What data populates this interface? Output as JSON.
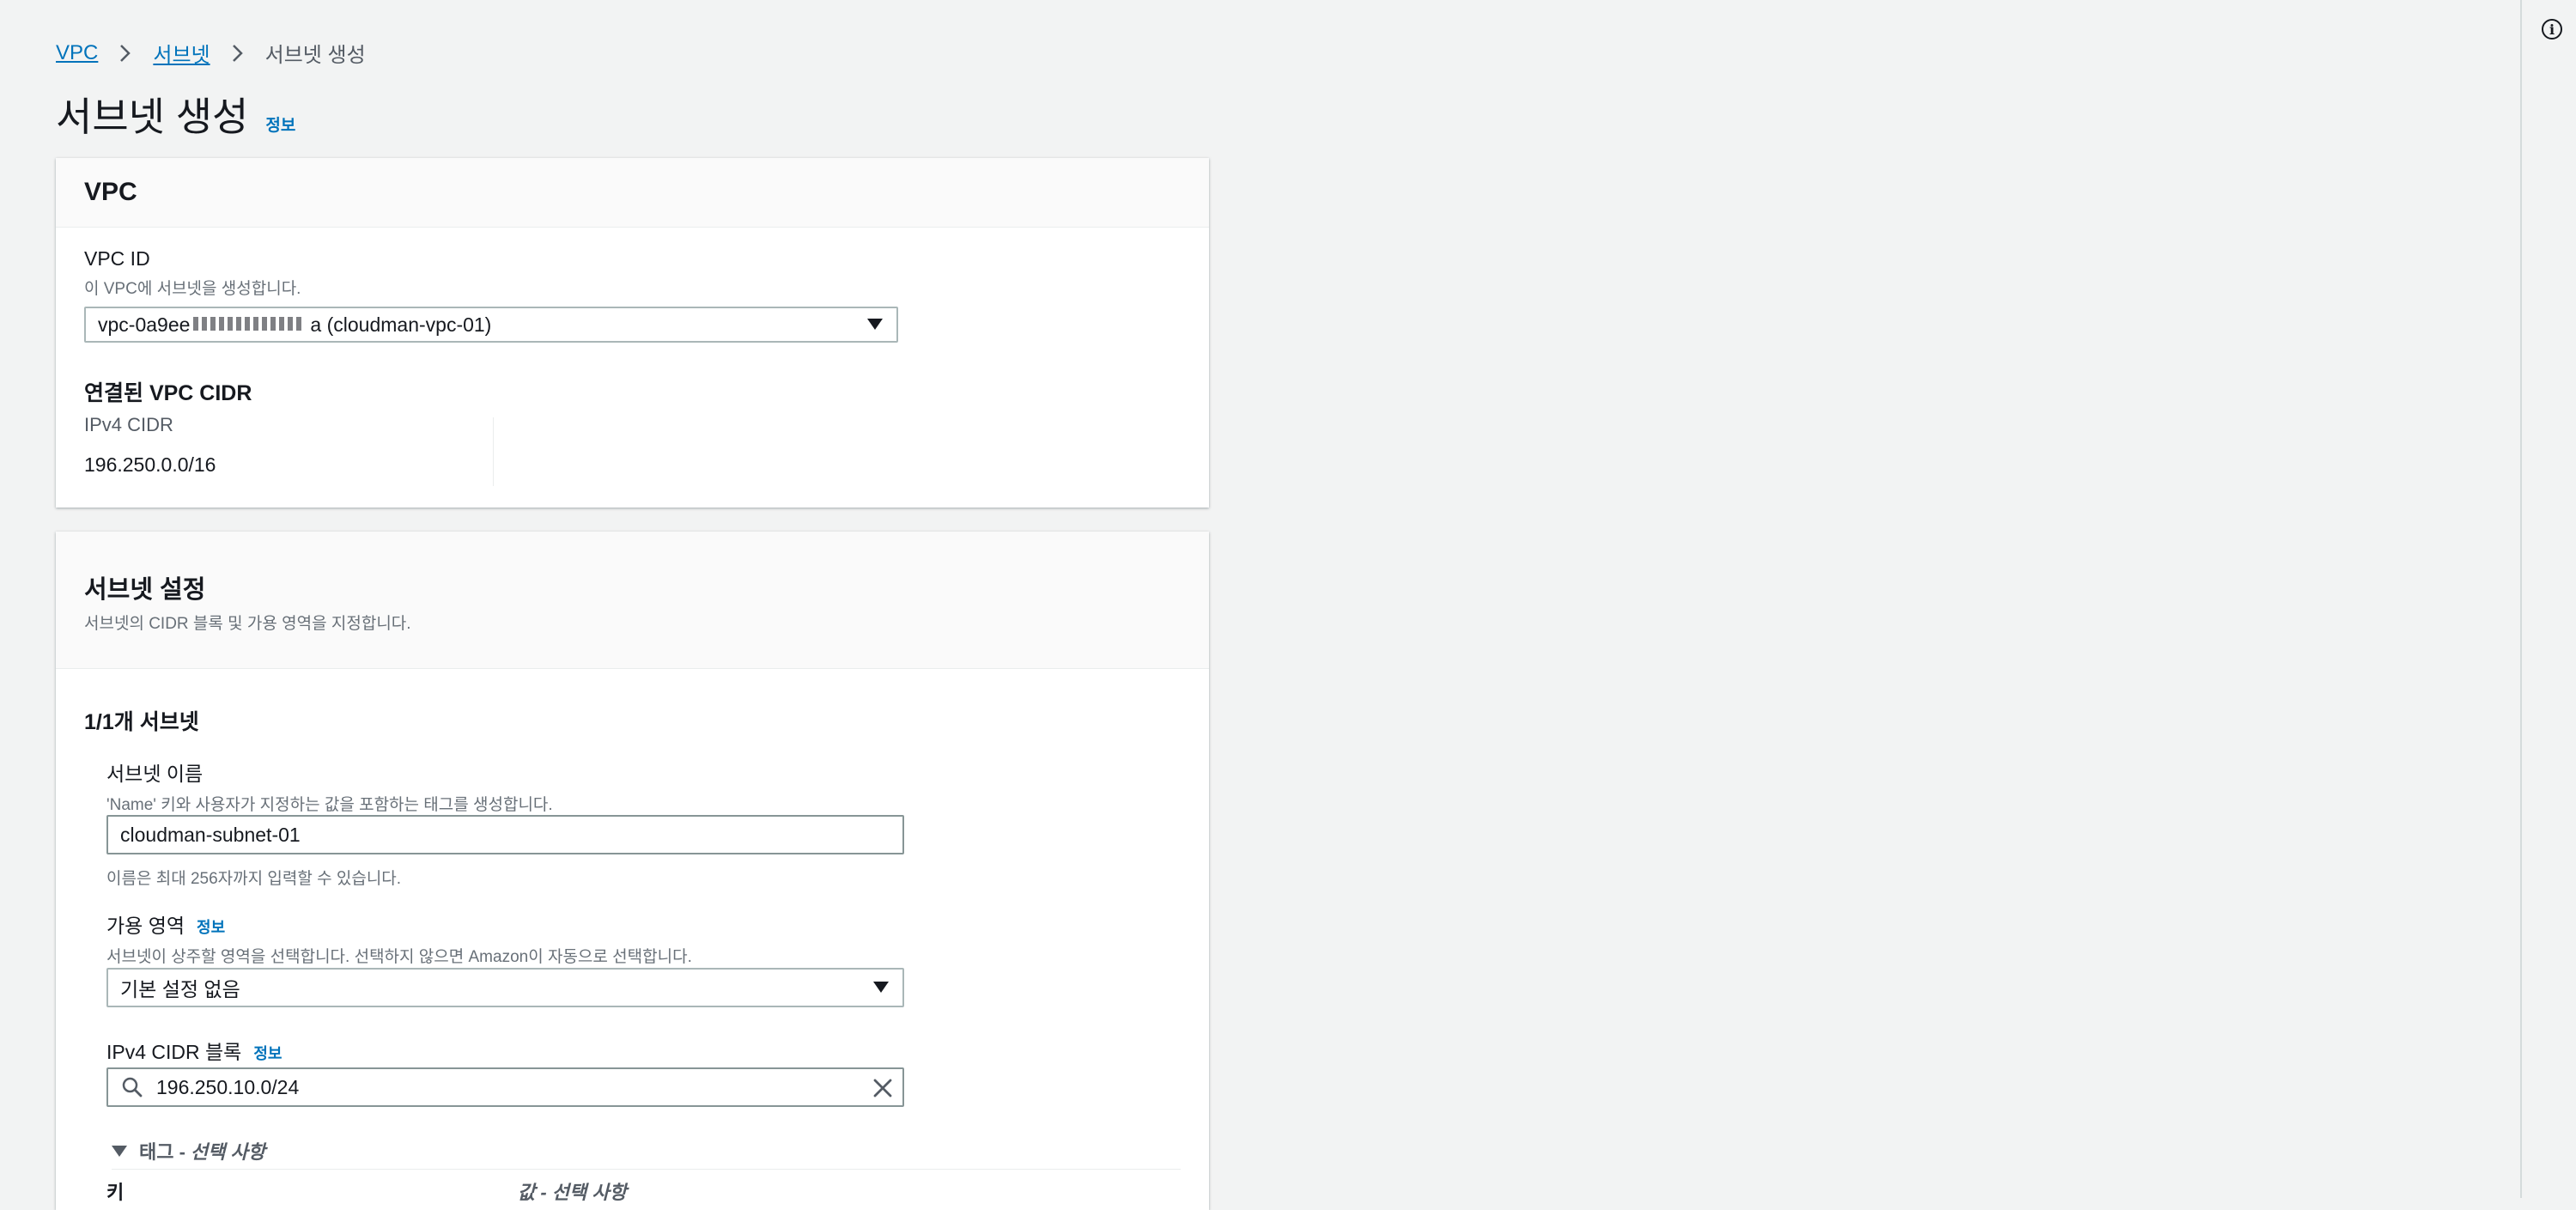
{
  "breadcrumb": {
    "items": [
      "VPC",
      "서브넷"
    ],
    "current": "서브넷 생성"
  },
  "page": {
    "title": "서브넷 생성",
    "info": "정보"
  },
  "vpc_section": {
    "title": "VPC",
    "vpc_id_label": "VPC ID",
    "vpc_id_desc": "이 VPC에 서브넷을 생성합니다.",
    "vpc_select_prefix": "vpc-0a9ee",
    "vpc_select_suffix": "a (cloudman-vpc-01)",
    "cidr_title": "연결된 VPC CIDR",
    "ipv4_label": "IPv4 CIDR",
    "ipv4_value": "196.250.0.0/16"
  },
  "subnet_section": {
    "title": "서브넷 설정",
    "desc": "서브넷의 CIDR 블록 및 가용 영역을 지정합니다.",
    "count_label": "1/1개 서브넷",
    "name_label": "서브넷 이름",
    "name_desc": "'Name' 키와 사용자가 지정하는 값을 포함하는 태그를 생성합니다.",
    "name_value": "cloudman-subnet-01",
    "name_hint": "이름은 최대 256자까지 입력할 수 있습니다.",
    "az_label": "가용 영역",
    "az_info": "정보",
    "az_desc": "서브넷이 상주할 영역을 선택합니다. 선택하지 않으면 Amazon이 자동으로 선택합니다.",
    "az_value": "기본 설정 없음",
    "cidr_label": "IPv4 CIDR 블록",
    "cidr_info": "정보",
    "cidr_value": "196.250.10.0/24",
    "tags_label": "태그 -",
    "tags_optional": "선택 사항",
    "key_col": "키",
    "value_col": "값 - 선택 사항"
  },
  "icons": {
    "breadcrumb_separator": "chevron-right-icon",
    "select_caret": "caret-down-icon",
    "search": "search-icon",
    "clear": "close-icon",
    "tags_toggle": "caret-down-icon",
    "rail": "info-icon"
  }
}
